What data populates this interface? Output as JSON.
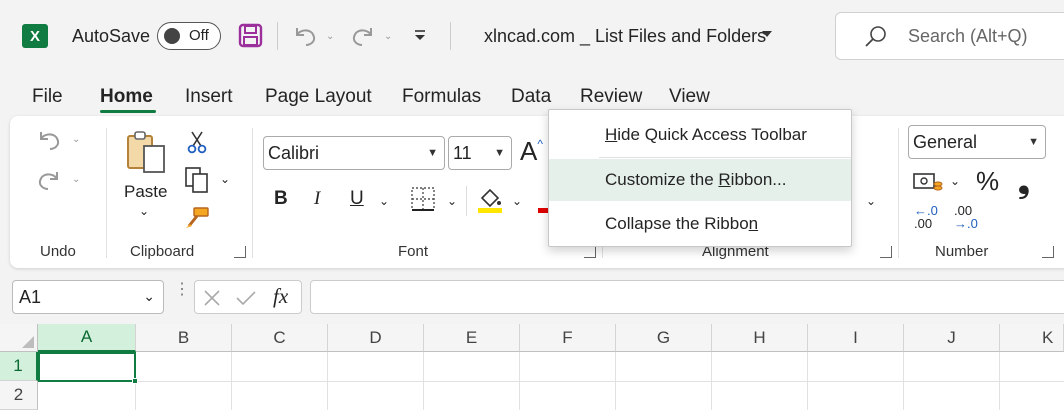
{
  "titlebar": {
    "app_logo": "X",
    "autosave_label": "AutoSave",
    "autosave_state": "Off",
    "doc_title": "xlncad.com _ List Files and Folders",
    "search_placeholder": "Search (Alt+Q)"
  },
  "menu": {
    "tabs": [
      "File",
      "Home",
      "Insert",
      "Page Layout",
      "Formulas",
      "Data",
      "Review",
      "View"
    ],
    "active": "Home"
  },
  "ribbon": {
    "groups": {
      "undo": "Undo",
      "clipboard": "Clipboard",
      "font": "Font",
      "alignment": "Alignment",
      "number": "Number"
    },
    "paste_label": "Paste",
    "font_name": "Calibri",
    "font_size": "11",
    "grow_font": "A",
    "bold": "B",
    "italic": "I",
    "underline": "U",
    "number_format": "General",
    "percent": "%",
    "comma": "❟",
    "inc_decimal_top": "←.0",
    "inc_decimal_bottom": ".00",
    "dec_decimal_top": ".00",
    "dec_decimal_bottom": "→.0"
  },
  "context_menu": {
    "items": [
      {
        "pre": "",
        "key": "H",
        "post": "ide Quick Access Toolbar"
      },
      {
        "pre": "Customize the ",
        "key": "R",
        "post": "ibbon..."
      },
      {
        "pre": "Collapse the Ribbo",
        "key": "n",
        "post": ""
      }
    ]
  },
  "formula_bar": {
    "name_box": "A1",
    "fx": "fx",
    "formula": ""
  },
  "grid": {
    "columns": [
      "A",
      "B",
      "C",
      "D",
      "E",
      "F",
      "G",
      "H",
      "I",
      "J",
      "K"
    ],
    "rows": [
      "1",
      "2"
    ],
    "selected_col": "A",
    "selected_row": "1"
  },
  "colors": {
    "accent": "#107c41",
    "highlight_yellow": "#ffe600",
    "font_red": "#e00000"
  }
}
